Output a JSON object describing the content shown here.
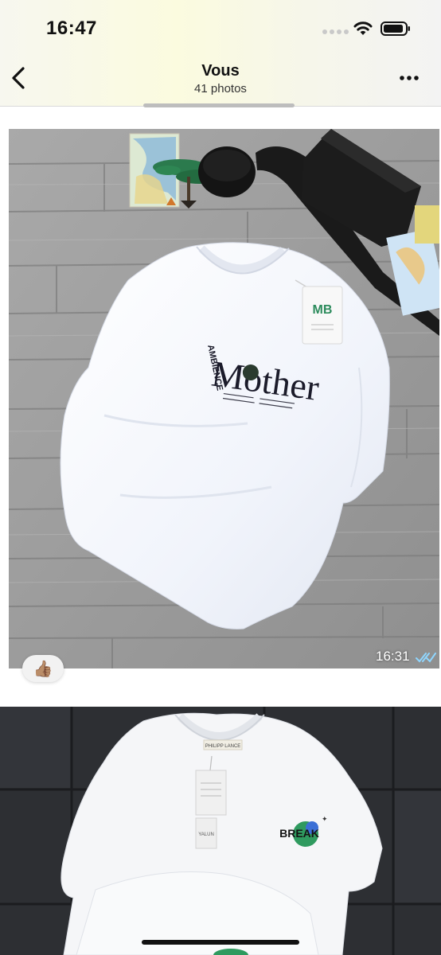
{
  "status_bar": {
    "time": "16:47"
  },
  "header": {
    "title": "Vous",
    "subtitle": "41 photos"
  },
  "photos": [
    {
      "description_icon": "photo-thumbnail",
      "shirt_print": {
        "brand_line": "Mother",
        "sub_line": "AMBIENCE",
        "tag_logo": "MB"
      },
      "timestamp": "16:31",
      "reaction": "👍🏽"
    },
    {
      "description_icon": "photo-thumbnail",
      "shirt_print": {
        "patch_text": "BREAK",
        "label_text": "PHILIPP LANCE",
        "tag_text": "YALUN"
      }
    }
  ],
  "colors": {
    "accent_blue": "#2f8ff3",
    "read_tick": "#8fd6ff"
  }
}
